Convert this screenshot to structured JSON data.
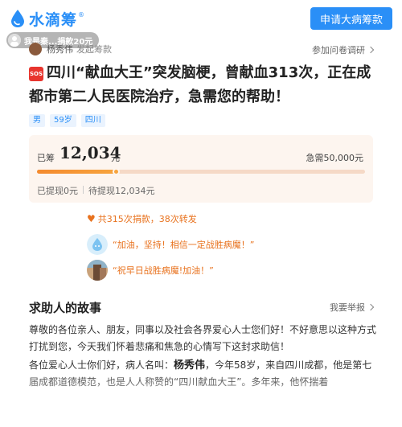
{
  "header": {
    "logo_text": "水滴筹",
    "logo_reg": "®",
    "apply_button": "申请大病筹款"
  },
  "toast": {
    "text": "我是秦...捐款20元"
  },
  "initiator": {
    "name": "杨秀伟",
    "role": "发起筹款",
    "report_link": "参加问卷调研"
  },
  "title": {
    "badge": "SOS",
    "text": "四川“献血大王”突发脑梗，曾献血313次，正在成都市第二人民医院治疗，急需您的帮助！"
  },
  "tags": [
    "男",
    "59岁",
    "四川"
  ],
  "fundraising": {
    "raised_label": "已筹",
    "raised_amount": "12,034",
    "raised_unit": "元",
    "need_text": "急需50,000元",
    "progress": 0.24,
    "withdrawn": "已提现0元",
    "pending": "待提现12,034元"
  },
  "support": {
    "stats": "共315次捐款，38次转发",
    "comments": [
      {
        "text": "“加油，坚持！相信一定战胜病魔！”"
      },
      {
        "text": "“祝早日战胜病魔!加油！”"
      }
    ]
  },
  "story": {
    "title": "求助人的故事",
    "report_link": "我要举报",
    "p1": "尊敬的各位亲人、朋友，同事以及社会各界爱心人士您们好！不好意思以这种方式打扰到您，今天我们怀着悲痛和焦急的心情写下这封求助信！",
    "p2_a": "各位爱心人士你们好，病人名叫：",
    "p2_name": "杨秀伟",
    "p2_b": "，今年58岁，来自四川成都，他是第七届成都道德模范，也是人人称赞的“四川献血大王”。多年来，他怀揣着"
  }
}
